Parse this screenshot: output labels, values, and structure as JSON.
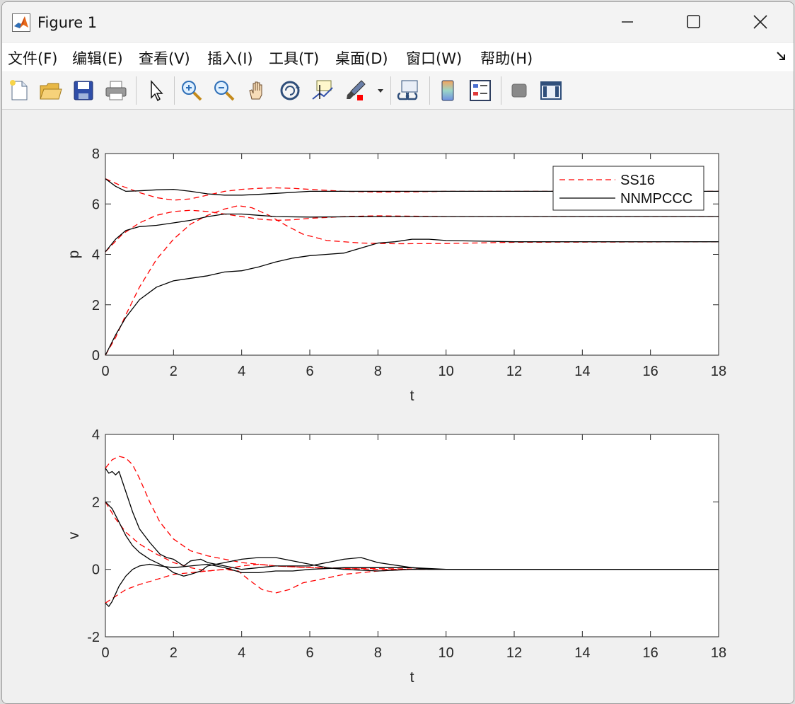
{
  "window": {
    "title": "Figure 1"
  },
  "menu": {
    "items": [
      "文件(F)",
      "编辑(E)",
      "查看(V)",
      "插入(I)",
      "工具(T)",
      "桌面(D)",
      "窗口(W)",
      "帮助(H)"
    ]
  },
  "toolbar": {
    "buttons": [
      "new-figure-icon",
      "open-icon",
      "save-icon",
      "print-icon",
      "pointer-icon",
      "zoom-in-icon",
      "zoom-out-icon",
      "pan-icon",
      "rotate-3d-icon",
      "data-cursor-icon",
      "brush-icon",
      "link-plot-icon",
      "colorbar-icon",
      "legend-icon",
      "hide-plot-tools-icon",
      "show-plot-tools-icon"
    ]
  },
  "colors": {
    "ss16": "#ff0000",
    "nnmpccc": "#000000"
  },
  "chart_data": [
    {
      "type": "line",
      "xlabel": "t",
      "ylabel": "p",
      "xlim": [
        0,
        18
      ],
      "ylim": [
        0,
        8
      ],
      "xticks": [
        "0",
        "2",
        "4",
        "6",
        "8",
        "10",
        "12",
        "14",
        "16",
        "18"
      ],
      "yticks": [
        "0",
        "2",
        "4",
        "6",
        "8"
      ],
      "legend": {
        "position": "top-right",
        "entries": [
          "SS16",
          "NNMPCCC"
        ]
      },
      "series": [
        {
          "name": "SS16",
          "style": "dashed",
          "color": "#ff0000",
          "x": [
            0,
            0.5,
            1,
            1.5,
            2,
            2.5,
            3,
            3.5,
            4,
            4.5,
            5,
            5.5,
            6,
            7,
            8,
            9,
            10,
            12,
            18
          ],
          "y": [
            7,
            6.7,
            6.45,
            6.25,
            6.15,
            6.2,
            6.35,
            6.5,
            6.58,
            6.62,
            6.64,
            6.62,
            6.58,
            6.5,
            6.47,
            6.48,
            6.5,
            6.5,
            6.5
          ]
        },
        {
          "name": "SS16",
          "style": "dashed",
          "color": "#ff0000",
          "x": [
            0,
            0.3,
            0.6,
            1,
            1.5,
            2,
            2.5,
            3,
            3.5,
            3.9,
            4.3,
            4.8,
            5.3,
            5.8,
            6.5,
            7.5,
            8.5,
            10,
            12,
            18
          ],
          "y": [
            0,
            0.7,
            1.6,
            2.7,
            3.8,
            4.6,
            5.2,
            5.55,
            5.8,
            5.93,
            5.85,
            5.55,
            5.15,
            4.8,
            4.55,
            4.45,
            4.42,
            4.43,
            4.48,
            4.5
          ]
        },
        {
          "name": "SS16",
          "style": "dashed",
          "color": "#ff0000",
          "x": [
            0,
            0.5,
            1,
            1.5,
            2,
            2.5,
            3,
            3.5,
            4,
            4.5,
            5,
            5.5,
            6,
            7,
            8,
            10,
            18
          ],
          "y": [
            4.1,
            4.8,
            5.25,
            5.55,
            5.7,
            5.75,
            5.7,
            5.6,
            5.5,
            5.4,
            5.35,
            5.37,
            5.43,
            5.5,
            5.53,
            5.5,
            5.5
          ]
        },
        {
          "name": "NNMPCCC",
          "style": "solid",
          "color": "#000000",
          "x": [
            0,
            0.3,
            0.6,
            1,
            1.5,
            2,
            2.5,
            3,
            3.5,
            4,
            4.5,
            5,
            6,
            8,
            10,
            18
          ],
          "y": [
            7,
            6.7,
            6.5,
            6.52,
            6.56,
            6.58,
            6.5,
            6.4,
            6.35,
            6.35,
            6.38,
            6.42,
            6.5,
            6.5,
            6.5,
            6.5
          ]
        },
        {
          "name": "NNMPCCC",
          "style": "solid",
          "color": "#000000",
          "x": [
            0,
            0.3,
            0.6,
            1,
            1.5,
            2,
            2.5,
            3,
            3.5,
            4,
            4.5,
            5,
            5.5,
            6,
            6.5,
            7,
            7.5,
            8,
            8.5,
            9,
            9.5,
            10,
            12,
            18
          ],
          "y": [
            0,
            0.8,
            1.5,
            2.2,
            2.7,
            2.95,
            3.05,
            3.15,
            3.3,
            3.35,
            3.5,
            3.7,
            3.85,
            3.95,
            4,
            4.05,
            4.25,
            4.45,
            4.5,
            4.6,
            4.6,
            4.55,
            4.5,
            4.5
          ]
        },
        {
          "name": "NNMPCCC",
          "style": "solid",
          "color": "#000000",
          "x": [
            0,
            0.3,
            0.6,
            1,
            1.5,
            2,
            2.5,
            3,
            3.5,
            4,
            4.5,
            5,
            6,
            8,
            10,
            18
          ],
          "y": [
            4.1,
            4.6,
            4.95,
            5.1,
            5.15,
            5.25,
            5.35,
            5.5,
            5.6,
            5.6,
            5.55,
            5.5,
            5.48,
            5.5,
            5.5,
            5.5
          ]
        }
      ]
    },
    {
      "type": "line",
      "xlabel": "t",
      "ylabel": "v",
      "xlim": [
        0,
        18
      ],
      "ylim": [
        -2,
        4
      ],
      "xticks": [
        "0",
        "2",
        "4",
        "6",
        "8",
        "10",
        "12",
        "14",
        "16",
        "18"
      ],
      "yticks": [
        "-2",
        "0",
        "2",
        "4"
      ],
      "series": [
        {
          "name": "SS16",
          "style": "dashed",
          "color": "#ff0000",
          "x": [
            0,
            0.2,
            0.4,
            0.6,
            0.8,
            1,
            1.3,
            1.6,
            2,
            2.5,
            3,
            3.5,
            4,
            5,
            6,
            8,
            10,
            18
          ],
          "y": [
            3,
            3.25,
            3.35,
            3.3,
            3.1,
            2.7,
            2,
            1.4,
            0.9,
            0.55,
            0.4,
            0.3,
            0.2,
            0.1,
            0.05,
            0.02,
            0,
            0
          ]
        },
        {
          "name": "SS16",
          "style": "dashed",
          "color": "#ff0000",
          "x": [
            0,
            0.3,
            0.6,
            1,
            1.5,
            2,
            2.5,
            3,
            3.5,
            4,
            4.5,
            5,
            6,
            8,
            10,
            18
          ],
          "y": [
            2,
            1.5,
            1.1,
            0.75,
            0.45,
            0.2,
            0.05,
            -0.05,
            0,
            0.1,
            0.15,
            0.1,
            0.05,
            0,
            0,
            0
          ]
        },
        {
          "name": "SS16",
          "style": "dashed",
          "color": "#ff0000",
          "x": [
            0,
            0.3,
            0.6,
            1,
            1.5,
            2,
            2.5,
            3,
            3.5,
            3.9,
            4.2,
            4.6,
            5,
            5.4,
            5.8,
            6.3,
            7,
            8,
            9,
            10,
            18
          ],
          "y": [
            -1,
            -0.8,
            -0.6,
            -0.45,
            -0.3,
            -0.15,
            -0.1,
            -0.05,
            0,
            -0.05,
            -0.3,
            -0.6,
            -0.7,
            -0.6,
            -0.4,
            -0.3,
            -0.15,
            -0.05,
            0,
            0,
            0
          ]
        },
        {
          "name": "NNMPCCC",
          "style": "solid",
          "color": "#000000",
          "x": [
            0,
            0.1,
            0.2,
            0.3,
            0.4,
            0.6,
            0.8,
            1,
            1.3,
            1.6,
            1.8,
            2,
            2.3,
            2.5,
            2.8,
            3,
            3.5,
            4,
            4.5,
            5,
            6,
            7,
            7.5,
            8,
            9,
            9.5,
            10,
            18
          ],
          "y": [
            3,
            2.85,
            2.9,
            2.8,
            2.9,
            2.3,
            1.7,
            1.2,
            0.8,
            0.45,
            0.35,
            0.3,
            0.1,
            0.25,
            0.3,
            0.2,
            0.1,
            0,
            0.05,
            0.1,
            0.1,
            0.3,
            0.35,
            0.2,
            0.05,
            0,
            0,
            0
          ]
        },
        {
          "name": "NNMPCCC",
          "style": "solid",
          "color": "#000000",
          "x": [
            0,
            0.2,
            0.4,
            0.6,
            0.8,
            1,
            1.3,
            1.5,
            1.8,
            2,
            2.3,
            2.5,
            2.8,
            3,
            3.5,
            4,
            4.5,
            5,
            5.5,
            6,
            6.5,
            7,
            8,
            9,
            10,
            18
          ],
          "y": [
            2,
            1.8,
            1.4,
            1,
            0.7,
            0.5,
            0.3,
            0.2,
            0.05,
            -0.1,
            -0.2,
            -0.15,
            -0.05,
            0.1,
            0.2,
            0.3,
            0.35,
            0.35,
            0.25,
            0.15,
            0.05,
            0,
            -0.05,
            0,
            0,
            0
          ]
        },
        {
          "name": "NNMPCCC",
          "style": "solid",
          "color": "#000000",
          "x": [
            0,
            0.1,
            0.2,
            0.4,
            0.6,
            0.8,
            1,
            1.3,
            1.6,
            2,
            2.5,
            3,
            3.5,
            4,
            4.5,
            5,
            5.5,
            6,
            7,
            8,
            9,
            10,
            18
          ],
          "y": [
            -1,
            -1.1,
            -0.95,
            -0.5,
            -0.2,
            0,
            0.1,
            0.15,
            0.1,
            0.05,
            0.1,
            0.15,
            0.05,
            -0.1,
            -0.1,
            -0.05,
            -0.05,
            0,
            0.05,
            0.05,
            0.05,
            0,
            0
          ]
        }
      ]
    }
  ]
}
